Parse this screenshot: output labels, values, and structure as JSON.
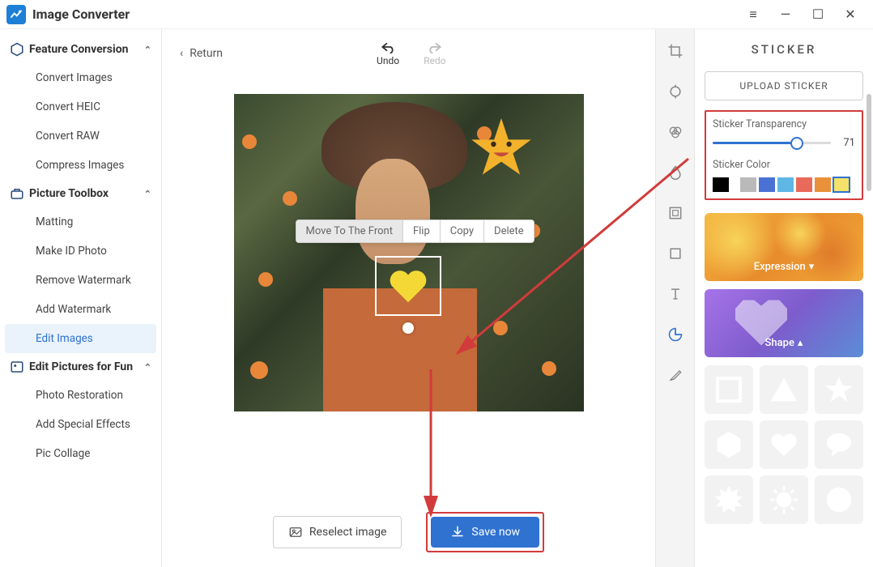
{
  "app": {
    "title": "Image Converter"
  },
  "windowControls": {
    "menu": "≡",
    "min": "—",
    "max": "☐",
    "close": "✕"
  },
  "sidebar": {
    "sections": [
      {
        "label": "Feature Conversion",
        "items": [
          "Convert Images",
          "Convert HEIC",
          "Convert RAW",
          "Compress Images"
        ]
      },
      {
        "label": "Picture Toolbox",
        "items": [
          "Matting",
          "Make ID Photo",
          "Remove Watermark",
          "Add Watermark",
          "Edit Images"
        ],
        "activeIndex": 4
      },
      {
        "label": "Edit Pictures for Fun",
        "items": [
          "Photo Restoration",
          "Add Special Effects",
          "Pic Collage"
        ]
      }
    ]
  },
  "canvas": {
    "return": "Return",
    "undo": "Undo",
    "redo": "Redo",
    "contextMenu": [
      "Move To The Front",
      "Flip",
      "Copy",
      "Delete"
    ],
    "reselect": "Reselect image",
    "save": "Save now"
  },
  "tools": [
    "crop",
    "adjust",
    "filter",
    "blur",
    "frame",
    "square",
    "text",
    "sticker",
    "brush"
  ],
  "panel": {
    "title": "STICKER",
    "upload": "UPLOAD STICKER",
    "transparencyLabel": "Sticker Transparency",
    "transparencyValue": "71",
    "colorLabel": "Sticker Color",
    "swatches": [
      "#000000",
      "#b9b9b9",
      "#4a72d4",
      "#5fb7e6",
      "#e86a5a",
      "#e8913a",
      "#f4e26a"
    ],
    "swatchSelected": 6,
    "categories": {
      "expression": "Expression",
      "shape": "Shape"
    },
    "shapes": [
      "square",
      "triangle",
      "star",
      "hexagon",
      "heart",
      "speech",
      "burst",
      "sun",
      "circle"
    ]
  }
}
